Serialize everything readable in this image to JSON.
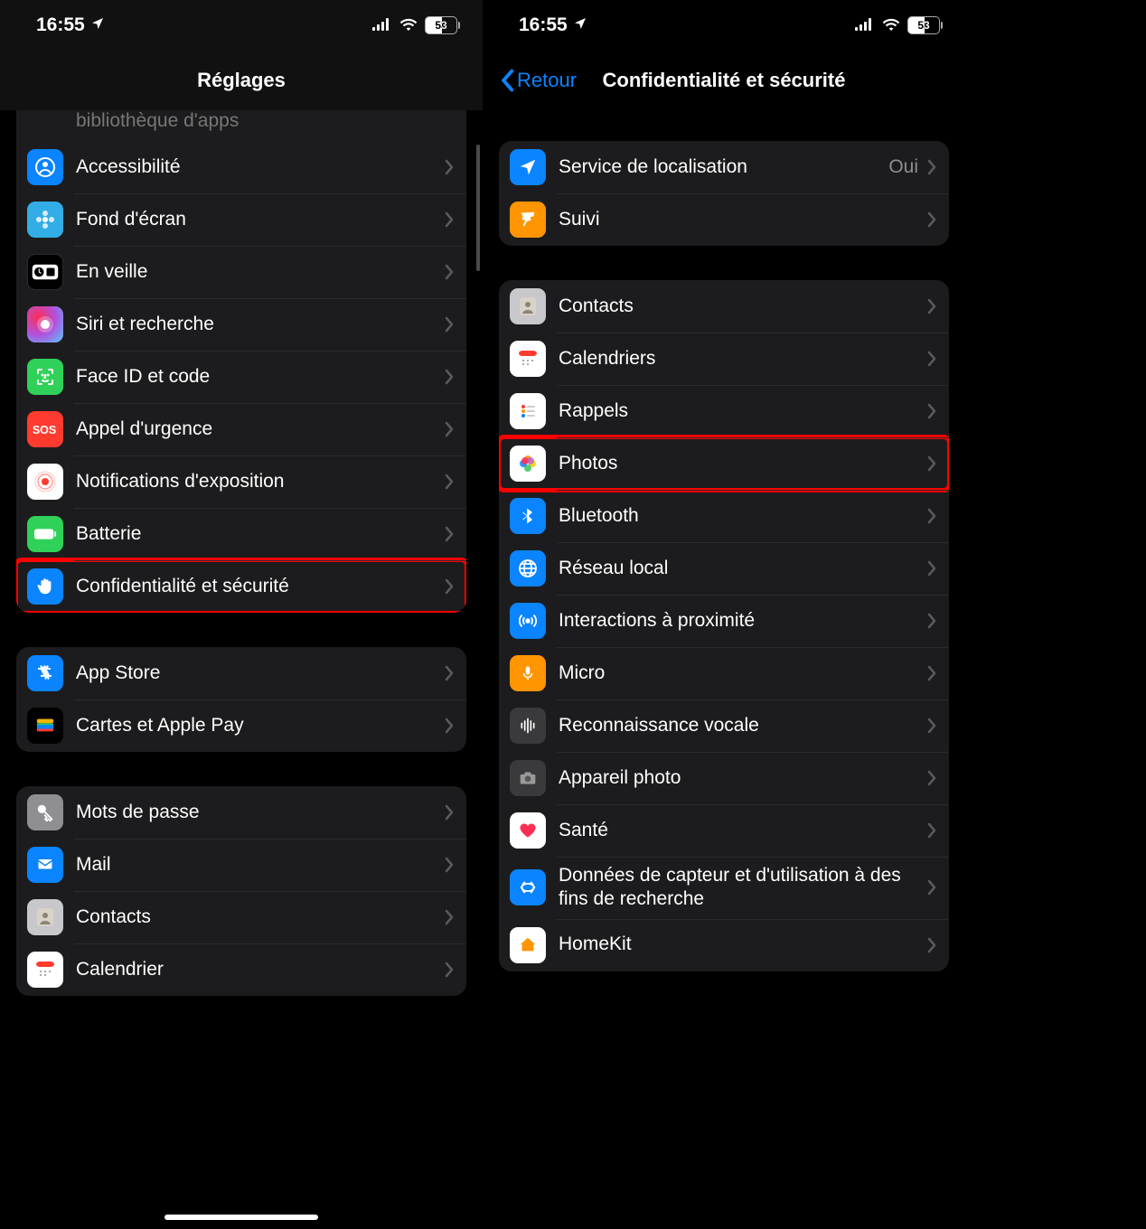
{
  "status": {
    "time": "16:55",
    "battery": "53"
  },
  "left": {
    "title": "Réglages",
    "truncated": "bibliothèque d'apps",
    "section1": [
      {
        "name": "accessibility",
        "label": "Accessibilité",
        "iconBg": "bg-blue",
        "glyph": "person"
      },
      {
        "name": "wallpaper",
        "label": "Fond d'écran",
        "iconBg": "bg-cyan",
        "glyph": "flower"
      },
      {
        "name": "standby",
        "label": "En veille",
        "iconBg": "bg-black",
        "glyph": "clock"
      },
      {
        "name": "siri",
        "label": "Siri et recherche",
        "iconBg": "bg-siri",
        "glyph": "siri"
      },
      {
        "name": "faceid",
        "label": "Face ID et code",
        "iconBg": "bg-green",
        "glyph": "faceid"
      },
      {
        "name": "sos",
        "label": "Appel d'urgence",
        "iconBg": "bg-red",
        "glyph": "sos"
      },
      {
        "name": "exposure",
        "label": "Notifications d'exposition",
        "iconBg": "bg-white",
        "glyph": "exposure"
      },
      {
        "name": "battery",
        "label": "Batterie",
        "iconBg": "bg-green",
        "glyph": "battery"
      },
      {
        "name": "privacy",
        "label": "Confidentialité et sécurité",
        "iconBg": "bg-blue",
        "glyph": "hand",
        "highlight": true
      }
    ],
    "section2": [
      {
        "name": "appstore",
        "label": "App Store",
        "iconBg": "bg-blue",
        "glyph": "appstore"
      },
      {
        "name": "wallet",
        "label": "Cartes et Apple Pay",
        "iconBg": "bg-wallet",
        "glyph": "wallet"
      }
    ],
    "section3": [
      {
        "name": "passwords",
        "label": "Mots de passe",
        "iconBg": "bg-gray",
        "glyph": "key"
      },
      {
        "name": "mail",
        "label": "Mail",
        "iconBg": "bg-blue",
        "glyph": "mail"
      },
      {
        "name": "contacts",
        "label": "Contacts",
        "iconBg": "bg-graylight",
        "glyph": "contacts"
      },
      {
        "name": "calendar",
        "label": "Calendrier",
        "iconBg": "bg-white",
        "glyph": "calendar"
      }
    ]
  },
  "right": {
    "back": "Retour",
    "title": "Confidentialité et sécurité",
    "section1": [
      {
        "name": "location",
        "label": "Service de localisation",
        "value": "Oui",
        "iconBg": "bg-blue",
        "glyph": "location"
      },
      {
        "name": "tracking",
        "label": "Suivi",
        "iconBg": "bg-orange",
        "glyph": "tracking"
      }
    ],
    "section2": [
      {
        "name": "contacts",
        "label": "Contacts",
        "iconBg": "bg-graylight",
        "glyph": "contacts"
      },
      {
        "name": "calendars",
        "label": "Calendriers",
        "iconBg": "bg-white",
        "glyph": "calendar"
      },
      {
        "name": "reminders",
        "label": "Rappels",
        "iconBg": "bg-white",
        "glyph": "reminders"
      },
      {
        "name": "photos",
        "label": "Photos",
        "iconBg": "bg-white",
        "glyph": "photos",
        "highlight": true
      },
      {
        "name": "bluetooth",
        "label": "Bluetooth",
        "iconBg": "bg-blue",
        "glyph": "bluetooth"
      },
      {
        "name": "localnet",
        "label": "Réseau local",
        "iconBg": "bg-blue",
        "glyph": "globe"
      },
      {
        "name": "nearby",
        "label": "Interactions à proximité",
        "iconBg": "bg-blue",
        "glyph": "nearby"
      },
      {
        "name": "mic",
        "label": "Micro",
        "iconBg": "bg-orange",
        "glyph": "mic"
      },
      {
        "name": "speech",
        "label": "Reconnaissance vocale",
        "iconBg": "bg-darkgray",
        "glyph": "speech"
      },
      {
        "name": "camera",
        "label": "Appareil photo",
        "iconBg": "bg-darkgray",
        "glyph": "camera"
      },
      {
        "name": "health",
        "label": "Santé",
        "iconBg": "bg-white",
        "glyph": "health"
      },
      {
        "name": "research",
        "label": "Données de capteur et d'utilisation à des fins de recherche",
        "iconBg": "bg-blue",
        "glyph": "research"
      },
      {
        "name": "homekit",
        "label": "HomeKit",
        "iconBg": "bg-white",
        "glyph": "homekit"
      }
    ]
  }
}
